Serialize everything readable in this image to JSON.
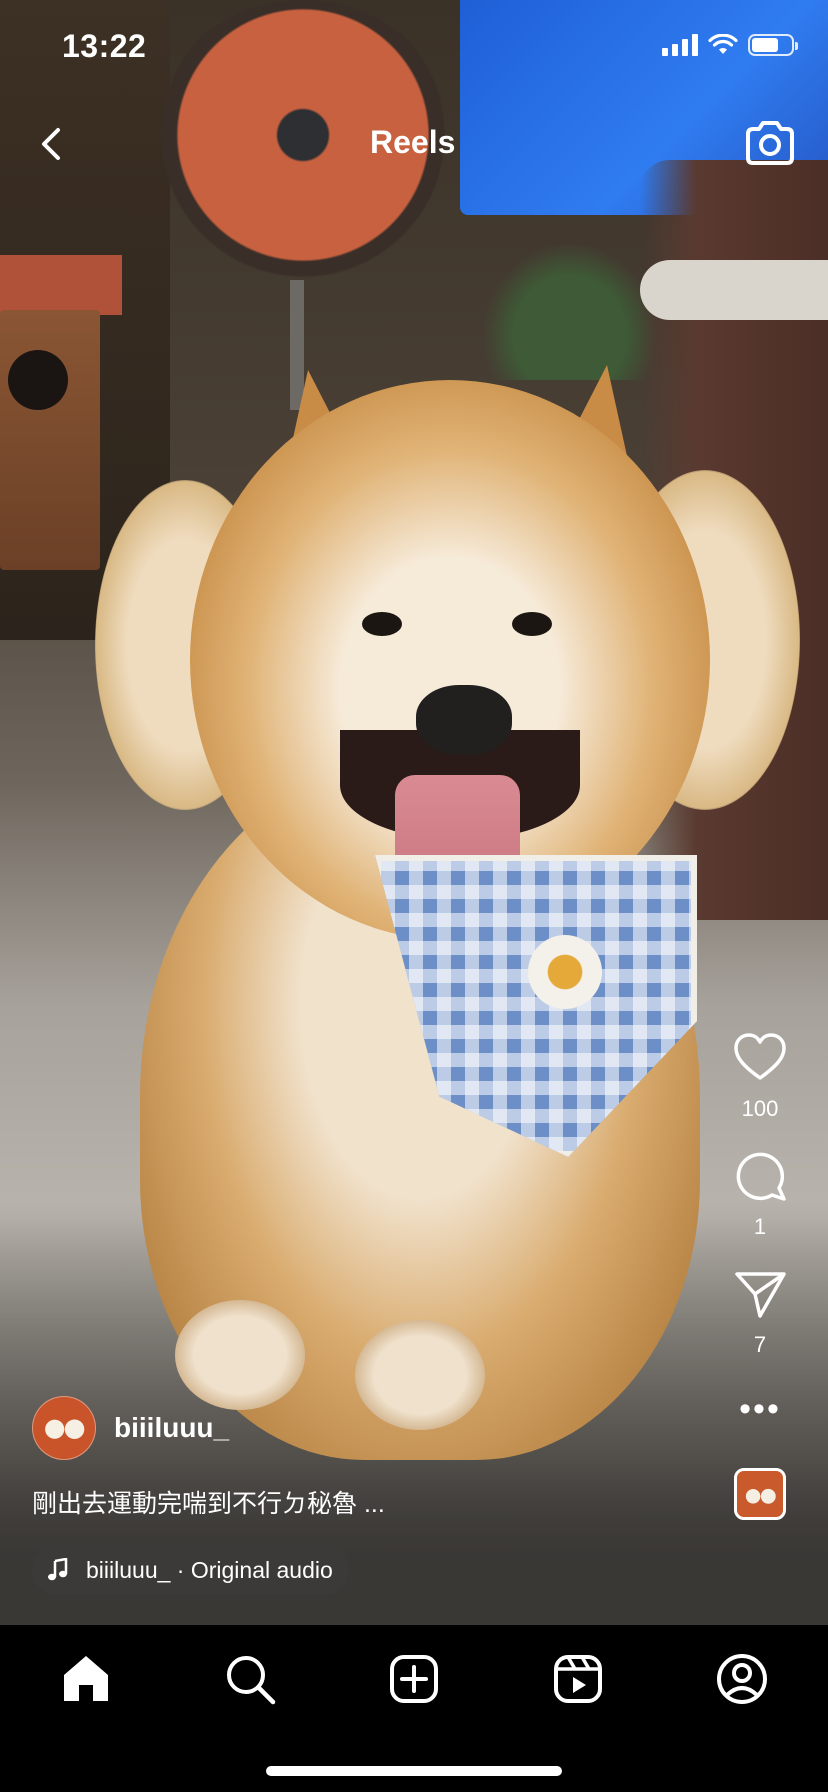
{
  "status_bar": {
    "time": "13:22"
  },
  "header": {
    "title": "Reels"
  },
  "actions": {
    "likes": "100",
    "comments": "1",
    "shares": "7"
  },
  "post": {
    "username": "biiiluuu_",
    "caption": "剛出去運動完喘到不行ㄉ秘魯 ...",
    "audio": "biiiluuu_ · Original audio"
  },
  "tabbar": {
    "items": [
      "home-icon",
      "search-icon",
      "create-icon",
      "reels-icon",
      "profile-icon"
    ],
    "active": "home"
  },
  "colors": {
    "background": "#000000",
    "text": "#ffffff",
    "accent_avatar": "#c9542a"
  }
}
